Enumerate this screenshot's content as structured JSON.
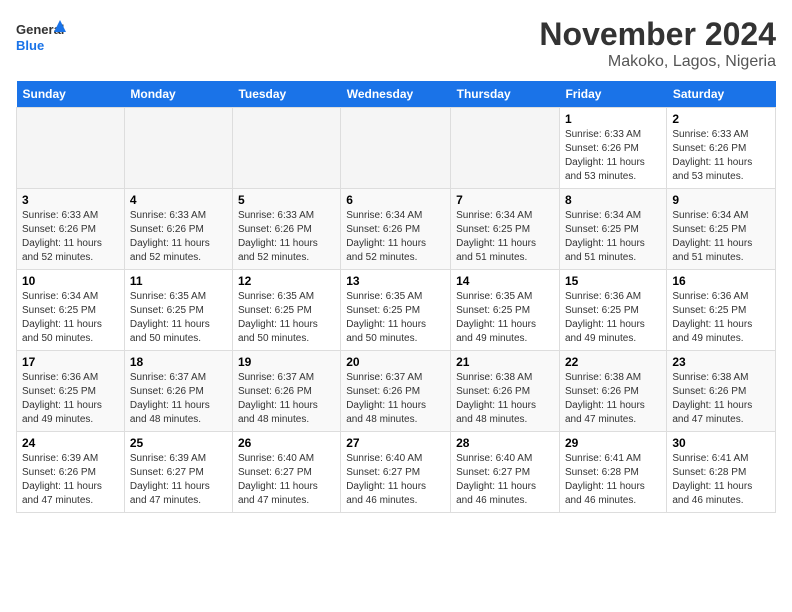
{
  "logo": {
    "line1": "General",
    "line2": "Blue"
  },
  "title": "November 2024",
  "subtitle": "Makoko, Lagos, Nigeria",
  "days_of_week": [
    "Sunday",
    "Monday",
    "Tuesday",
    "Wednesday",
    "Thursday",
    "Friday",
    "Saturday"
  ],
  "weeks": [
    [
      {
        "day": "",
        "info": ""
      },
      {
        "day": "",
        "info": ""
      },
      {
        "day": "",
        "info": ""
      },
      {
        "day": "",
        "info": ""
      },
      {
        "day": "",
        "info": ""
      },
      {
        "day": "1",
        "info": "Sunrise: 6:33 AM\nSunset: 6:26 PM\nDaylight: 11 hours and 53 minutes."
      },
      {
        "day": "2",
        "info": "Sunrise: 6:33 AM\nSunset: 6:26 PM\nDaylight: 11 hours and 53 minutes."
      }
    ],
    [
      {
        "day": "3",
        "info": "Sunrise: 6:33 AM\nSunset: 6:26 PM\nDaylight: 11 hours and 52 minutes."
      },
      {
        "day": "4",
        "info": "Sunrise: 6:33 AM\nSunset: 6:26 PM\nDaylight: 11 hours and 52 minutes."
      },
      {
        "day": "5",
        "info": "Sunrise: 6:33 AM\nSunset: 6:26 PM\nDaylight: 11 hours and 52 minutes."
      },
      {
        "day": "6",
        "info": "Sunrise: 6:34 AM\nSunset: 6:26 PM\nDaylight: 11 hours and 52 minutes."
      },
      {
        "day": "7",
        "info": "Sunrise: 6:34 AM\nSunset: 6:25 PM\nDaylight: 11 hours and 51 minutes."
      },
      {
        "day": "8",
        "info": "Sunrise: 6:34 AM\nSunset: 6:25 PM\nDaylight: 11 hours and 51 minutes."
      },
      {
        "day": "9",
        "info": "Sunrise: 6:34 AM\nSunset: 6:25 PM\nDaylight: 11 hours and 51 minutes."
      }
    ],
    [
      {
        "day": "10",
        "info": "Sunrise: 6:34 AM\nSunset: 6:25 PM\nDaylight: 11 hours and 50 minutes."
      },
      {
        "day": "11",
        "info": "Sunrise: 6:35 AM\nSunset: 6:25 PM\nDaylight: 11 hours and 50 minutes."
      },
      {
        "day": "12",
        "info": "Sunrise: 6:35 AM\nSunset: 6:25 PM\nDaylight: 11 hours and 50 minutes."
      },
      {
        "day": "13",
        "info": "Sunrise: 6:35 AM\nSunset: 6:25 PM\nDaylight: 11 hours and 50 minutes."
      },
      {
        "day": "14",
        "info": "Sunrise: 6:35 AM\nSunset: 6:25 PM\nDaylight: 11 hours and 49 minutes."
      },
      {
        "day": "15",
        "info": "Sunrise: 6:36 AM\nSunset: 6:25 PM\nDaylight: 11 hours and 49 minutes."
      },
      {
        "day": "16",
        "info": "Sunrise: 6:36 AM\nSunset: 6:25 PM\nDaylight: 11 hours and 49 minutes."
      }
    ],
    [
      {
        "day": "17",
        "info": "Sunrise: 6:36 AM\nSunset: 6:25 PM\nDaylight: 11 hours and 49 minutes."
      },
      {
        "day": "18",
        "info": "Sunrise: 6:37 AM\nSunset: 6:26 PM\nDaylight: 11 hours and 48 minutes."
      },
      {
        "day": "19",
        "info": "Sunrise: 6:37 AM\nSunset: 6:26 PM\nDaylight: 11 hours and 48 minutes."
      },
      {
        "day": "20",
        "info": "Sunrise: 6:37 AM\nSunset: 6:26 PM\nDaylight: 11 hours and 48 minutes."
      },
      {
        "day": "21",
        "info": "Sunrise: 6:38 AM\nSunset: 6:26 PM\nDaylight: 11 hours and 48 minutes."
      },
      {
        "day": "22",
        "info": "Sunrise: 6:38 AM\nSunset: 6:26 PM\nDaylight: 11 hours and 47 minutes."
      },
      {
        "day": "23",
        "info": "Sunrise: 6:38 AM\nSunset: 6:26 PM\nDaylight: 11 hours and 47 minutes."
      }
    ],
    [
      {
        "day": "24",
        "info": "Sunrise: 6:39 AM\nSunset: 6:26 PM\nDaylight: 11 hours and 47 minutes."
      },
      {
        "day": "25",
        "info": "Sunrise: 6:39 AM\nSunset: 6:27 PM\nDaylight: 11 hours and 47 minutes."
      },
      {
        "day": "26",
        "info": "Sunrise: 6:40 AM\nSunset: 6:27 PM\nDaylight: 11 hours and 47 minutes."
      },
      {
        "day": "27",
        "info": "Sunrise: 6:40 AM\nSunset: 6:27 PM\nDaylight: 11 hours and 46 minutes."
      },
      {
        "day": "28",
        "info": "Sunrise: 6:40 AM\nSunset: 6:27 PM\nDaylight: 11 hours and 46 minutes."
      },
      {
        "day": "29",
        "info": "Sunrise: 6:41 AM\nSunset: 6:28 PM\nDaylight: 11 hours and 46 minutes."
      },
      {
        "day": "30",
        "info": "Sunrise: 6:41 AM\nSunset: 6:28 PM\nDaylight: 11 hours and 46 minutes."
      }
    ]
  ]
}
